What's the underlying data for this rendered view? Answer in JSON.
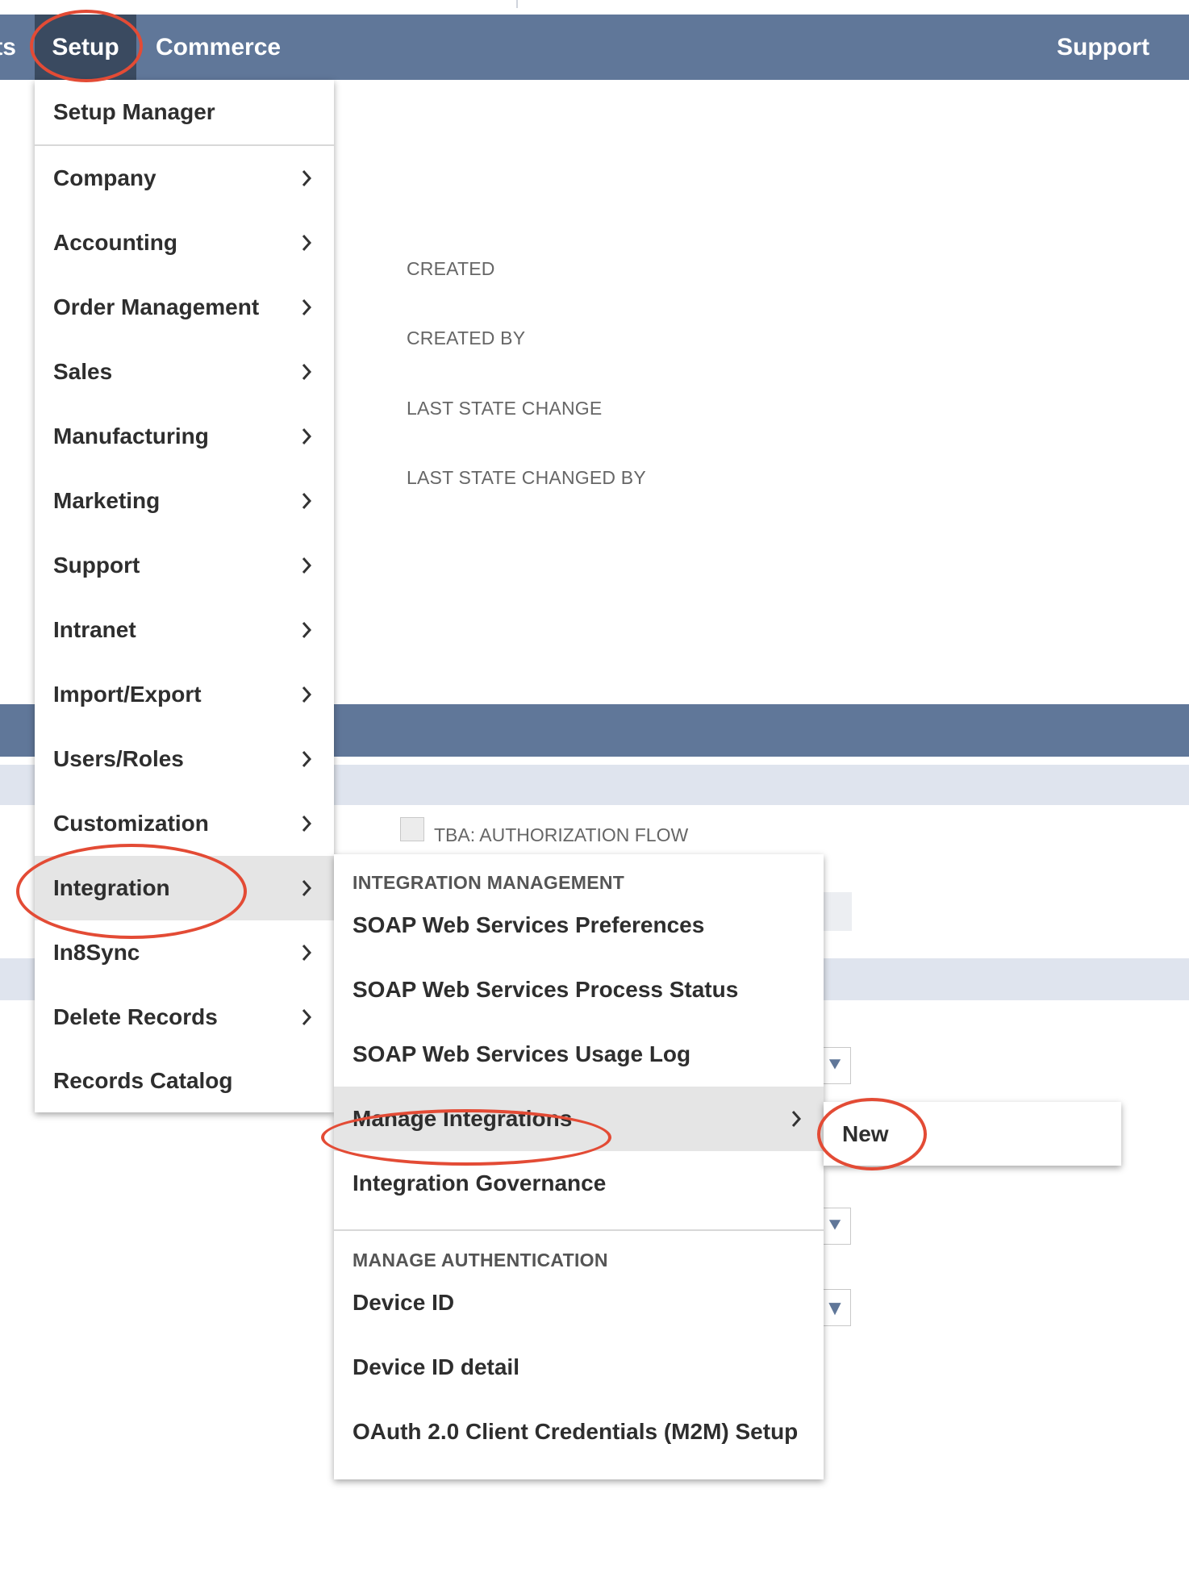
{
  "nav": {
    "prev_item_fragment": "ts",
    "setup": "Setup",
    "commerce": "Commerce",
    "support": "Support"
  },
  "form": {
    "created_label": "CREATED",
    "created_by_label": "CREATED BY",
    "last_state_change_label": "LAST STATE CHANGE",
    "last_state_changed_by_label": "LAST STATE CHANGED BY",
    "tba_checkbox_label": "TBA: AUTHORIZATION FLOW"
  },
  "setup_menu": {
    "items": [
      {
        "label": "Setup Manager"
      },
      {
        "label": "Company"
      },
      {
        "label": "Accounting"
      },
      {
        "label": "Order Management"
      },
      {
        "label": "Sales"
      },
      {
        "label": "Manufacturing"
      },
      {
        "label": "Marketing"
      },
      {
        "label": "Support"
      },
      {
        "label": "Intranet"
      },
      {
        "label": "Import/Export"
      },
      {
        "label": "Users/Roles"
      },
      {
        "label": "Customization"
      },
      {
        "label": "Integration"
      },
      {
        "label": "In8Sync"
      },
      {
        "label": "Delete Records"
      },
      {
        "label": "Records Catalog"
      }
    ]
  },
  "integration_menu": {
    "section_integration_management": "INTEGRATION MANAGEMENT",
    "items_a": [
      {
        "label": "SOAP Web Services Preferences"
      },
      {
        "label": "SOAP Web Services Process Status"
      },
      {
        "label": "SOAP Web Services Usage Log"
      },
      {
        "label": "Manage Integrations"
      },
      {
        "label": "Integration Governance"
      }
    ],
    "section_manage_authentication": "MANAGE AUTHENTICATION",
    "items_b": [
      {
        "label": "Device ID"
      },
      {
        "label": "Device ID detail"
      },
      {
        "label": "OAuth 2.0 Client Credentials (M2M) Setup"
      }
    ]
  },
  "manage_integrations_menu": {
    "new_label": "New"
  },
  "colors": {
    "nav_bg": "#607799",
    "nav_active_bg": "#3a4a60",
    "annotation_red": "#e34b35",
    "menu_active_bg": "#e5e5e5"
  }
}
